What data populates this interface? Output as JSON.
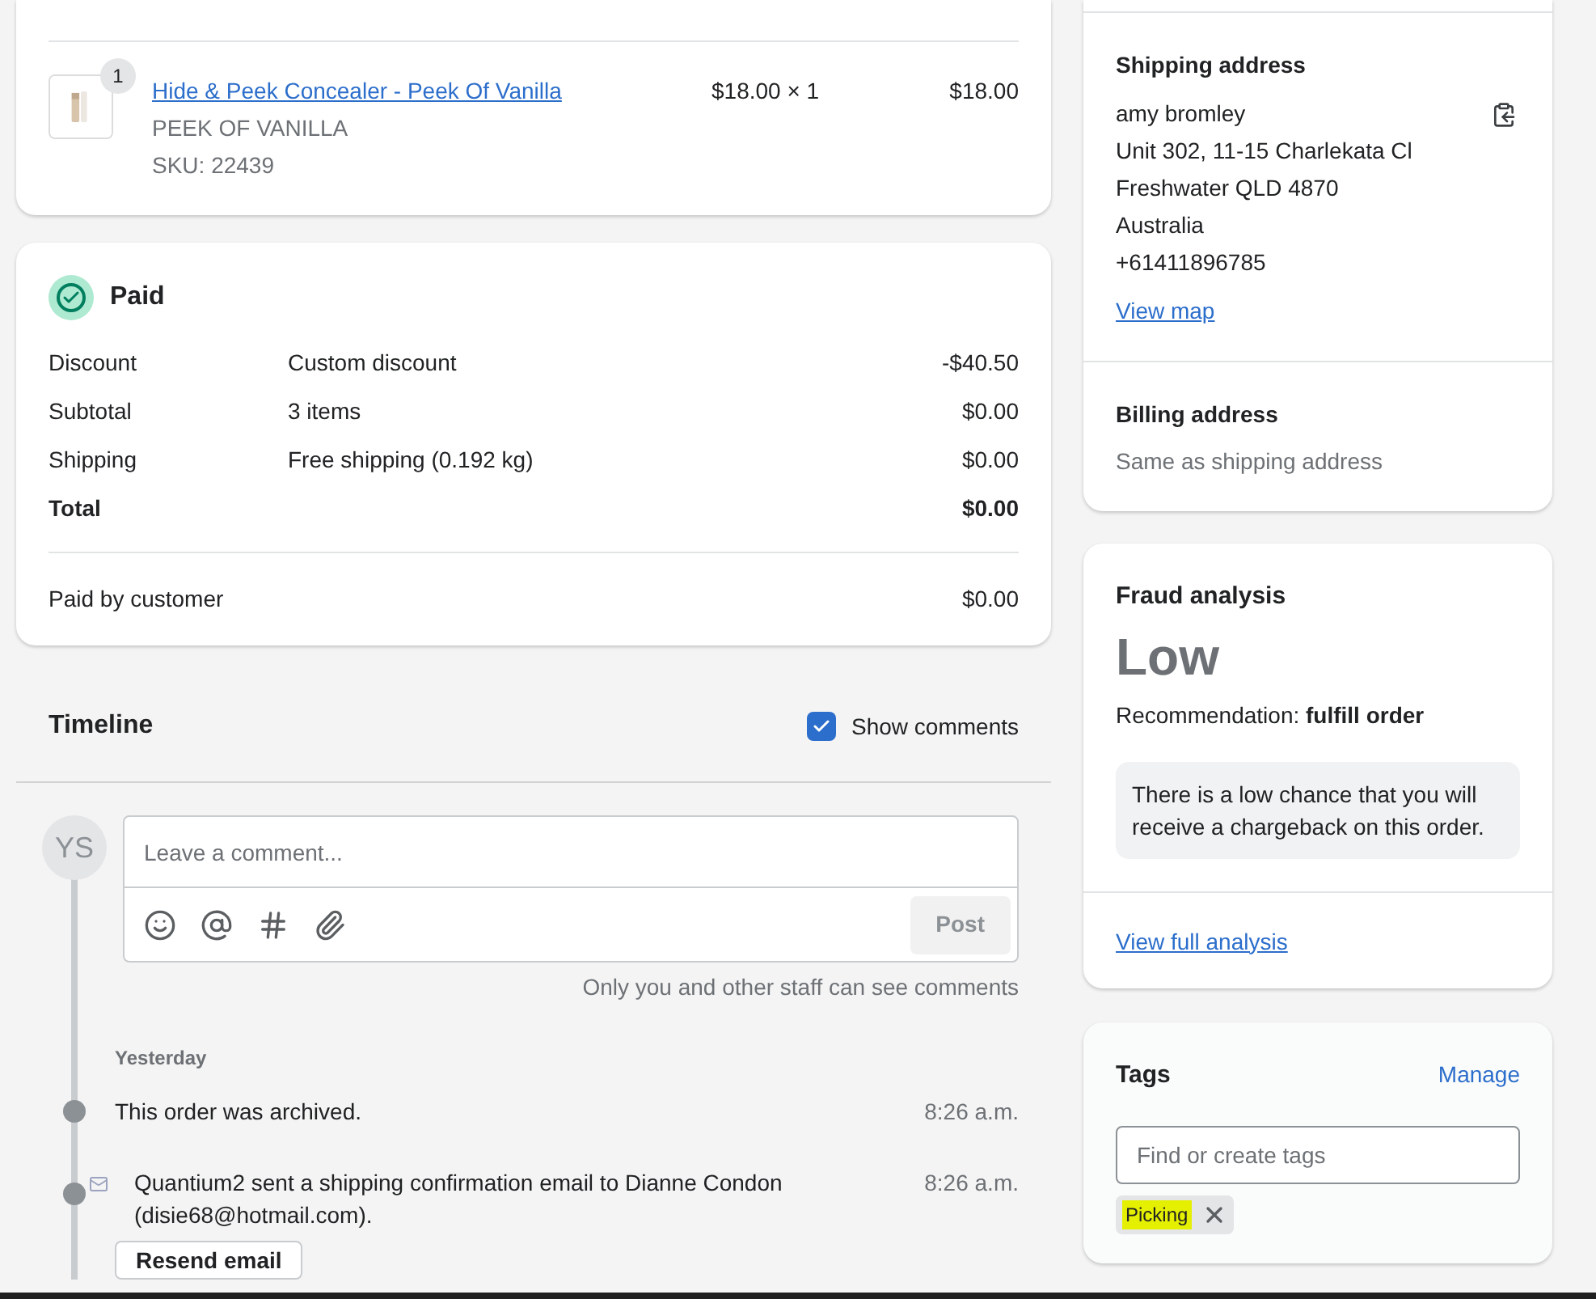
{
  "line_item": {
    "quantity_badge": "1",
    "title": "Hide & Peek Concealer - Peek Of Vanilla",
    "variant": "PEEK OF VANILLA",
    "sku": "SKU: 22439",
    "unit_price": "$18.00 × 1",
    "total": "$18.00"
  },
  "payment": {
    "status": "Paid",
    "rows": [
      {
        "label": "Discount",
        "detail": "Custom discount",
        "amount": "-$40.50",
        "bold": false
      },
      {
        "label": "Subtotal",
        "detail": "3 items",
        "amount": "$0.00",
        "bold": false
      },
      {
        "label": "Shipping",
        "detail": "Free shipping (0.192 kg)",
        "amount": "$0.00",
        "bold": false
      },
      {
        "label": "Total",
        "amount": "$0.00",
        "bold": true
      }
    ],
    "paid_by": {
      "label": "Paid by customer",
      "amount": "$0.00"
    }
  },
  "timeline": {
    "title": "Timeline",
    "show_comments": {
      "label": "Show comments",
      "checked": true
    },
    "avatar": "YS",
    "comment": {
      "placeholder": "Leave a comment...",
      "post": "Post"
    },
    "note": "Only you and other staff can see comments",
    "day": "Yesterday",
    "events": [
      {
        "text": "This order was archived.",
        "time": "8:26 a.m.",
        "has_icon": false
      },
      {
        "text": "Quantium2 sent a shipping confirmation email to Dianne Condon (disie68@hotmail.com).",
        "time": "8:26 a.m.",
        "has_icon": true,
        "button": "Resend email"
      }
    ]
  },
  "shipping_address": {
    "title": "Shipping address",
    "lines": [
      "amy bromley",
      "Unit 302, 11-15 Charlekata Cl",
      "Freshwater QLD 4870",
      "Australia",
      "+61411896785"
    ],
    "link": "View map"
  },
  "billing_address": {
    "title": "Billing address",
    "text": "Same as shipping address"
  },
  "fraud": {
    "title": "Fraud analysis",
    "level": "Low",
    "recommendation": "Recommendation: **fulfill order**",
    "note": "There is a low chance that you will receive a chargeback on this order.",
    "link": "View full analysis"
  },
  "tags": {
    "title": "Tags",
    "manage": "Manage",
    "placeholder": "Find or create tags",
    "items": [
      {
        "label": "Picking",
        "highlighted": true
      }
    ]
  }
}
